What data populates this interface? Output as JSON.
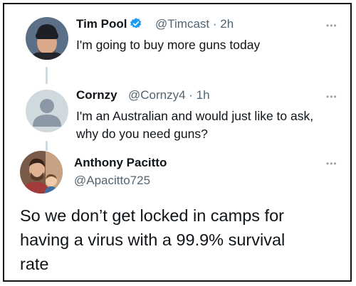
{
  "tweets": [
    {
      "display_name": "Tim Pool",
      "verified": true,
      "handle": "@Timcast",
      "time": "2h",
      "text": "I'm going to buy more guns today"
    },
    {
      "display_name": "Cornzy",
      "verified": false,
      "handle": "@Cornzy4",
      "time": "1h",
      "text_line1": "I'm an Australian and would just like to ask,",
      "text_line2": "why do you need guns?"
    },
    {
      "display_name": "Anthony Pacitto",
      "handle": "@Apacitto725",
      "text_line1": "So we don’t get locked in camps for",
      "text_line2": "having a virus with a 99.9% survival",
      "text_line3": "rate"
    }
  ],
  "colors": {
    "name": "#0f1419",
    "meta": "#536471",
    "verified": "#1d9bf0",
    "thread_line": "#cfd9de"
  },
  "icons": [
    "more-options-icon",
    "verified-badge-icon",
    "default-avatar-icon"
  ]
}
